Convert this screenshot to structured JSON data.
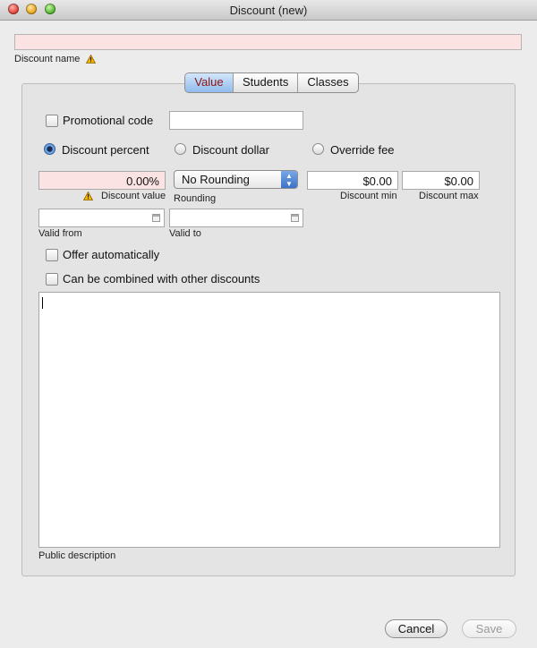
{
  "window": {
    "title": "Discount (new)"
  },
  "discount_name": {
    "value": "",
    "label": "Discount name"
  },
  "tabs": [
    {
      "label": "Value",
      "active": true
    },
    {
      "label": "Students",
      "active": false
    },
    {
      "label": "Classes",
      "active": false
    }
  ],
  "promo": {
    "label": "Promotional code",
    "checked": false,
    "value": ""
  },
  "discount_type": {
    "options": [
      {
        "label": "Discount percent",
        "selected": true
      },
      {
        "label": "Discount dollar",
        "selected": false
      },
      {
        "label": "Override fee",
        "selected": false
      }
    ]
  },
  "discount_value": {
    "value": "0.00%",
    "label": "Discount value"
  },
  "rounding": {
    "value": "No Rounding",
    "label": "Rounding"
  },
  "discount_min": {
    "value": "$0.00",
    "label": "Discount min"
  },
  "discount_max": {
    "value": "$0.00",
    "label": "Discount max"
  },
  "valid_from": {
    "value": "",
    "label": "Valid from"
  },
  "valid_to": {
    "value": "",
    "label": "Valid to"
  },
  "offer_auto": {
    "label": "Offer automatically",
    "checked": false
  },
  "combinable": {
    "label": "Can be combined with other discounts",
    "checked": false
  },
  "public_description": {
    "value": "",
    "label": "Public description"
  },
  "buttons": {
    "cancel": "Cancel",
    "save": "Save"
  },
  "colors": {
    "invalid_field_bg": "#fce3e3",
    "active_tab_text": "#8a1414",
    "warning": "#e8a300"
  }
}
